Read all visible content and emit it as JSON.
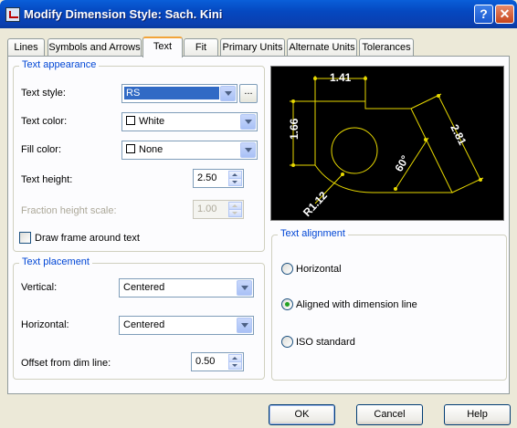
{
  "window": {
    "title": "Modify Dimension Style: Sach. Kini",
    "help_label": "?",
    "close_label": "✕"
  },
  "tabs": [
    {
      "label": "Lines"
    },
    {
      "label": "Symbols and Arrows"
    },
    {
      "label": "Text",
      "active": true
    },
    {
      "label": "Fit"
    },
    {
      "label": "Primary Units"
    },
    {
      "label": "Alternate Units"
    },
    {
      "label": "Tolerances"
    }
  ],
  "text_appearance": {
    "heading": "Text appearance",
    "text_style_label": "Text style:",
    "text_style_value": "RS",
    "text_style_button": "...",
    "text_color_label": "Text color:",
    "text_color_value": "White",
    "fill_color_label": "Fill color:",
    "fill_color_value": "None",
    "text_height_label": "Text height:",
    "text_height_value": "2.50",
    "fraction_label": "Fraction height scale:",
    "fraction_value": "1.00",
    "draw_frame_label": "Draw frame around text",
    "draw_frame_checked": false
  },
  "text_placement": {
    "heading": "Text placement",
    "vertical_label": "Vertical:",
    "vertical_value": "Centered",
    "horizontal_label": "Horizontal:",
    "horizontal_value": "Centered",
    "offset_label": "Offset from dim line:",
    "offset_value": "0.50"
  },
  "preview": {
    "dim_top": "1.41",
    "dim_left": "1.66",
    "dim_right": "2.81",
    "dim_angle": "60°",
    "dim_radius": "R1.12",
    "colors": {
      "background": "#000000",
      "geometry": "#ffff00",
      "text": "#ffffff"
    }
  },
  "text_alignment": {
    "heading": "Text alignment",
    "options": [
      {
        "label": "Horizontal",
        "selected": false
      },
      {
        "label": "Aligned with dimension line",
        "selected": true
      },
      {
        "label": "ISO standard",
        "selected": false
      }
    ]
  },
  "buttons": {
    "ok": "OK",
    "cancel": "Cancel",
    "help": "Help"
  },
  "colors": {
    "title_bar": "#0548c0",
    "group_heading": "#0046d5",
    "selection": "#316ac5"
  }
}
